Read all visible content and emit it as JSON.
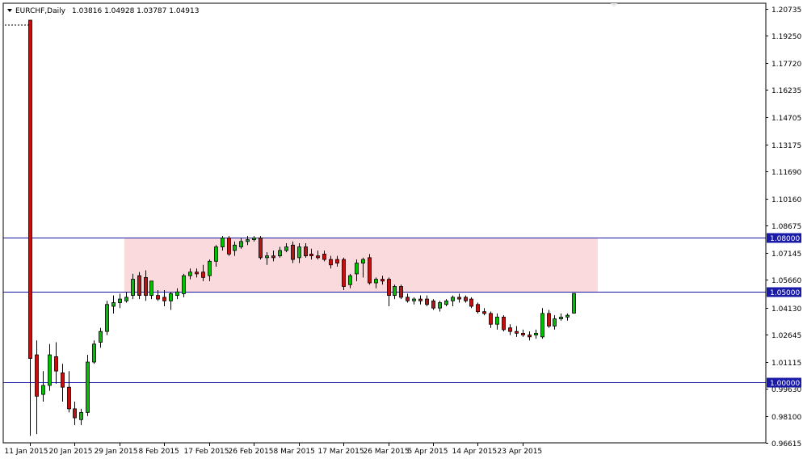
{
  "header": {
    "symbol": "EURCHF,Daily",
    "ohlc": "1.03816 1.04928 1.03787 1.04913"
  },
  "chart_data": {
    "type": "candlestick",
    "ylim": [
      0.9661,
      1.2104
    ],
    "y_ticks": [
      "1.20735",
      "1.19250",
      "1.17720",
      "1.16235",
      "1.14705",
      "1.13175",
      "1.11690",
      "1.10160",
      "1.08675",
      "1.07145",
      "1.05660",
      "1.04130",
      "1.02645",
      "1.01115",
      "0.99630",
      "0.98100",
      "0.96615"
    ],
    "x_tick_labels": [
      {
        "label": "11 Jan 2015",
        "index": 0
      },
      {
        "label": "20 Jan 2015",
        "index": 7
      },
      {
        "label": "29 Jan 2015",
        "index": 14
      },
      {
        "label": "8 Feb 2015",
        "index": 21
      },
      {
        "label": "17 Feb 2015",
        "index": 28
      },
      {
        "label": "26 Feb 2015",
        "index": 35
      },
      {
        "label": "8 Mar 2015",
        "index": 42
      },
      {
        "label": "17 Mar 2015",
        "index": 49
      },
      {
        "label": "26 Mar 2015",
        "index": 56
      },
      {
        "label": "5 Apr 2015",
        "index": 63
      },
      {
        "label": "14 Apr 2015",
        "index": 70
      },
      {
        "label": "23 Apr 2015",
        "index": 77
      }
    ],
    "levels": [
      {
        "label": "1.08000",
        "value": 1.08
      },
      {
        "label": "1.05000",
        "value": 1.05
      },
      {
        "label": "1.00000",
        "value": 1.0
      }
    ],
    "zone": {
      "from_value": 1.05,
      "to_value": 1.08,
      "start_index": 15,
      "end_index": 89,
      "color": "#fadadd"
    },
    "colors": {
      "bull": "#00c000",
      "bear": "#c01010",
      "level_line": "#1a1aa8",
      "level_tag": "#1a1aa8"
    },
    "candles": [
      {
        "o": 1.201,
        "h": 1.201,
        "l": 0.97,
        "c": 1.013
      },
      {
        "o": 1.015,
        "h": 1.023,
        "l": 0.971,
        "c": 0.992
      },
      {
        "o": 0.993,
        "h": 1.006,
        "l": 0.989,
        "c": 0.998
      },
      {
        "o": 0.998,
        "h": 1.021,
        "l": 0.995,
        "c": 1.015
      },
      {
        "o": 1.014,
        "h": 1.022,
        "l": 0.999,
        "c": 1.006
      },
      {
        "o": 1.005,
        "h": 1.01,
        "l": 0.989,
        "c": 0.997
      },
      {
        "o": 0.997,
        "h": 1.006,
        "l": 0.983,
        "c": 0.985
      },
      {
        "o": 0.985,
        "h": 0.989,
        "l": 0.976,
        "c": 0.98
      },
      {
        "o": 0.979,
        "h": 0.985,
        "l": 0.976,
        "c": 0.983
      },
      {
        "o": 0.983,
        "h": 1.015,
        "l": 0.981,
        "c": 1.011
      },
      {
        "o": 1.011,
        "h": 1.023,
        "l": 1.01,
        "c": 1.021
      },
      {
        "o": 1.022,
        "h": 1.03,
        "l": 1.019,
        "c": 1.028
      },
      {
        "o": 1.028,
        "h": 1.045,
        "l": 1.026,
        "c": 1.043
      },
      {
        "o": 1.042,
        "h": 1.048,
        "l": 1.038,
        "c": 1.044
      },
      {
        "o": 1.044,
        "h": 1.049,
        "l": 1.041,
        "c": 1.046
      },
      {
        "o": 1.045,
        "h": 1.05,
        "l": 1.044,
        "c": 1.047
      },
      {
        "o": 1.048,
        "h": 1.06,
        "l": 1.046,
        "c": 1.057
      },
      {
        "o": 1.059,
        "h": 1.061,
        "l": 1.046,
        "c": 1.048
      },
      {
        "o": 1.058,
        "h": 1.062,
        "l": 1.045,
        "c": 1.048
      },
      {
        "o": 1.048,
        "h": 1.056,
        "l": 1.046,
        "c": 1.056
      },
      {
        "o": 1.048,
        "h": 1.051,
        "l": 1.045,
        "c": 1.046
      },
      {
        "o": 1.047,
        "h": 1.051,
        "l": 1.042,
        "c": 1.045
      },
      {
        "o": 1.045,
        "h": 1.05,
        "l": 1.04,
        "c": 1.049
      },
      {
        "o": 1.048,
        "h": 1.052,
        "l": 1.046,
        "c": 1.05
      },
      {
        "o": 1.049,
        "h": 1.06,
        "l": 1.047,
        "c": 1.059
      },
      {
        "o": 1.059,
        "h": 1.063,
        "l": 1.057,
        "c": 1.061
      },
      {
        "o": 1.061,
        "h": 1.063,
        "l": 1.058,
        "c": 1.06
      },
      {
        "o": 1.061,
        "h": 1.065,
        "l": 1.056,
        "c": 1.058
      },
      {
        "o": 1.059,
        "h": 1.068,
        "l": 1.056,
        "c": 1.067
      },
      {
        "o": 1.067,
        "h": 1.076,
        "l": 1.064,
        "c": 1.075
      },
      {
        "o": 1.075,
        "h": 1.081,
        "l": 1.073,
        "c": 1.08
      },
      {
        "o": 1.08,
        "h": 1.081,
        "l": 1.07,
        "c": 1.071
      },
      {
        "o": 1.073,
        "h": 1.078,
        "l": 1.07,
        "c": 1.076
      },
      {
        "o": 1.075,
        "h": 1.08,
        "l": 1.074,
        "c": 1.078
      },
      {
        "o": 1.078,
        "h": 1.081,
        "l": 1.076,
        "c": 1.079
      },
      {
        "o": 1.079,
        "h": 1.081,
        "l": 1.078,
        "c": 1.08
      },
      {
        "o": 1.08,
        "h": 1.081,
        "l": 1.068,
        "c": 1.069
      },
      {
        "o": 1.069,
        "h": 1.072,
        "l": 1.065,
        "c": 1.07
      },
      {
        "o": 1.07,
        "h": 1.073,
        "l": 1.067,
        "c": 1.069
      },
      {
        "o": 1.07,
        "h": 1.075,
        "l": 1.069,
        "c": 1.073
      },
      {
        "o": 1.073,
        "h": 1.077,
        "l": 1.072,
        "c": 1.075
      },
      {
        "o": 1.076,
        "h": 1.078,
        "l": 1.066,
        "c": 1.068
      },
      {
        "o": 1.069,
        "h": 1.077,
        "l": 1.066,
        "c": 1.075
      },
      {
        "o": 1.075,
        "h": 1.077,
        "l": 1.069,
        "c": 1.07
      },
      {
        "o": 1.071,
        "h": 1.074,
        "l": 1.068,
        "c": 1.07
      },
      {
        "o": 1.07,
        "h": 1.073,
        "l": 1.068,
        "c": 1.069
      },
      {
        "o": 1.071,
        "h": 1.073,
        "l": 1.067,
        "c": 1.068
      },
      {
        "o": 1.068,
        "h": 1.07,
        "l": 1.063,
        "c": 1.065
      },
      {
        "o": 1.068,
        "h": 1.07,
        "l": 1.064,
        "c": 1.066
      },
      {
        "o": 1.068,
        "h": 1.069,
        "l": 1.051,
        "c": 1.053
      },
      {
        "o": 1.054,
        "h": 1.06,
        "l": 1.052,
        "c": 1.059
      },
      {
        "o": 1.06,
        "h": 1.068,
        "l": 1.056,
        "c": 1.066
      },
      {
        "o": 1.066,
        "h": 1.069,
        "l": 1.058,
        "c": 1.068
      },
      {
        "o": 1.069,
        "h": 1.071,
        "l": 1.054,
        "c": 1.055
      },
      {
        "o": 1.055,
        "h": 1.058,
        "l": 1.052,
        "c": 1.057
      },
      {
        "o": 1.057,
        "h": 1.059,
        "l": 1.054,
        "c": 1.056
      },
      {
        "o": 1.057,
        "h": 1.058,
        "l": 1.042,
        "c": 1.048
      },
      {
        "o": 1.048,
        "h": 1.054,
        "l": 1.046,
        "c": 1.053
      },
      {
        "o": 1.053,
        "h": 1.054,
        "l": 1.046,
        "c": 1.047
      },
      {
        "o": 1.047,
        "h": 1.049,
        "l": 1.044,
        "c": 1.045
      },
      {
        "o": 1.045,
        "h": 1.047,
        "l": 1.043,
        "c": 1.046
      },
      {
        "o": 1.046,
        "h": 1.048,
        "l": 1.043,
        "c": 1.045
      },
      {
        "o": 1.046,
        "h": 1.048,
        "l": 1.042,
        "c": 1.043
      },
      {
        "o": 1.045,
        "h": 1.046,
        "l": 1.04,
        "c": 1.041
      },
      {
        "o": 1.041,
        "h": 1.045,
        "l": 1.039,
        "c": 1.044
      },
      {
        "o": 1.043,
        "h": 1.046,
        "l": 1.042,
        "c": 1.045
      },
      {
        "o": 1.045,
        "h": 1.048,
        "l": 1.042,
        "c": 1.047
      },
      {
        "o": 1.047,
        "h": 1.049,
        "l": 1.044,
        "c": 1.046
      },
      {
        "o": 1.047,
        "h": 1.048,
        "l": 1.044,
        "c": 1.045
      },
      {
        "o": 1.046,
        "h": 1.047,
        "l": 1.041,
        "c": 1.042
      },
      {
        "o": 1.043,
        "h": 1.044,
        "l": 1.038,
        "c": 1.039
      },
      {
        "o": 1.039,
        "h": 1.041,
        "l": 1.037,
        "c": 1.038
      },
      {
        "o": 1.038,
        "h": 1.039,
        "l": 1.03,
        "c": 1.032
      },
      {
        "o": 1.032,
        "h": 1.038,
        "l": 1.029,
        "c": 1.036
      },
      {
        "o": 1.036,
        "h": 1.037,
        "l": 1.028,
        "c": 1.029
      },
      {
        "o": 1.03,
        "h": 1.032,
        "l": 1.026,
        "c": 1.028
      },
      {
        "o": 1.028,
        "h": 1.031,
        "l": 1.025,
        "c": 1.027
      },
      {
        "o": 1.027,
        "h": 1.029,
        "l": 1.025,
        "c": 1.026
      },
      {
        "o": 1.026,
        "h": 1.028,
        "l": 1.023,
        "c": 1.025
      },
      {
        "o": 1.026,
        "h": 1.029,
        "l": 1.024,
        "c": 1.027
      },
      {
        "o": 1.025,
        "h": 1.041,
        "l": 1.024,
        "c": 1.038
      },
      {
        "o": 1.038,
        "h": 1.04,
        "l": 1.03,
        "c": 1.031
      },
      {
        "o": 1.031,
        "h": 1.037,
        "l": 1.029,
        "c": 1.035
      },
      {
        "o": 1.035,
        "h": 1.038,
        "l": 1.034,
        "c": 1.036
      },
      {
        "o": 1.036,
        "h": 1.038,
        "l": 1.034,
        "c": 1.037
      },
      {
        "o": 1.0382,
        "h": 1.0493,
        "l": 1.0379,
        "c": 1.0491
      }
    ]
  }
}
